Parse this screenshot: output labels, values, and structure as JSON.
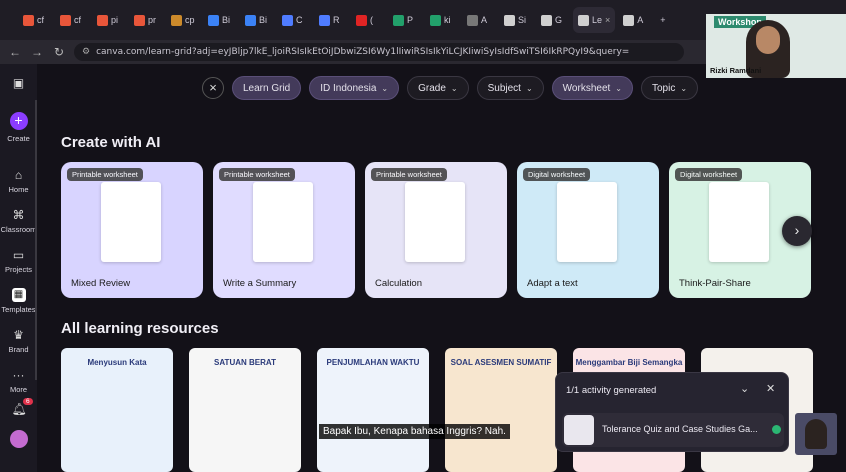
{
  "browser": {
    "tabs": [
      {
        "label": "cf",
        "color": "#e8563a"
      },
      {
        "label": "cf",
        "color": "#e8563a"
      },
      {
        "label": "pi",
        "color": "#e8563a"
      },
      {
        "label": "pr",
        "color": "#e8563a"
      },
      {
        "label": "cp",
        "color": "#cc8a2b"
      },
      {
        "label": "Bi",
        "color": "#3b82f6"
      },
      {
        "label": "Bi",
        "color": "#3b82f6"
      },
      {
        "label": "C",
        "color": "#4f7cff"
      },
      {
        "label": "R",
        "color": "#4f7cff"
      },
      {
        "label": "(",
        "color": "#e02424"
      },
      {
        "label": "P",
        "color": "#22a06b"
      },
      {
        "label": "ki",
        "color": "#22a06b"
      },
      {
        "label": "A",
        "color": "#777777"
      },
      {
        "label": "Si",
        "color": "#cfcfcf"
      },
      {
        "label": "G",
        "color": "#cfcfcf"
      },
      {
        "label": "Le",
        "color": "#cfcfcf",
        "active": true
      },
      {
        "label": "A",
        "color": "#cfcfcf"
      }
    ],
    "new_tab": "+",
    "url": "canva.com/learn-grid?adj=eyJBljp7lkE_ljoiRSIsIkEtOiJDbwiZSI6Wy1lIiwiRSIsIkYiLCJKIiwiSyIsIdfSwiTSI6IkRPQyI9&query="
  },
  "sidebar": {
    "items": [
      {
        "label": "Create",
        "icon": "plus-icon"
      },
      {
        "label": "Home",
        "icon": "home-icon"
      },
      {
        "label": "Classroom",
        "icon": "classroom-icon"
      },
      {
        "label": "Projects",
        "icon": "folder-icon"
      },
      {
        "label": "Templates",
        "icon": "templates-icon"
      },
      {
        "label": "Brand",
        "icon": "brand-icon"
      },
      {
        "label": "More",
        "icon": "more-icon"
      }
    ],
    "notification_count": "6"
  },
  "filters": {
    "chips": [
      {
        "label": "Learn Grid",
        "selected": true
      },
      {
        "label": "ID Indonesia",
        "selected": true,
        "dropdown": true
      },
      {
        "label": "Grade",
        "dropdown": true
      },
      {
        "label": "Subject",
        "dropdown": true
      },
      {
        "label": "Worksheet",
        "selected": true,
        "dropdown": true
      },
      {
        "label": "Topic",
        "dropdown": true
      }
    ]
  },
  "sections": {
    "ai_title": "Create with AI",
    "resources_title": "All learning resources"
  },
  "ai_cards": [
    {
      "tag": "Printable worksheet",
      "label": "Mixed Review",
      "color": "#d8d4ff"
    },
    {
      "tag": "Printable worksheet",
      "label": "Write a Summary",
      "color": "#e0dcff"
    },
    {
      "tag": "Printable worksheet",
      "label": "Calculation",
      "color": "#e6e4f7"
    },
    {
      "tag": "Digital worksheet",
      "label": "Adapt a text",
      "color": "#cfeaf7"
    },
    {
      "tag": "Digital worksheet",
      "label": "Think-Pair-Share",
      "color": "#d7f2e4"
    }
  ],
  "resources": [
    {
      "title": "Menyusun Kata",
      "bg": "#e8f1fb"
    },
    {
      "title": "SATUAN BERAT",
      "bg": "#f6f6f6"
    },
    {
      "title": "PENJUMLAHAN WAKTU",
      "bg": "#eef3fb"
    },
    {
      "title": "SOAL ASESMEN SUMATIF",
      "bg": "#f7e6cf"
    },
    {
      "title": "Menggambar Biji Semangka",
      "bg": "#fbe4e6"
    },
    {
      "title": "",
      "bg": "#f4f1ec"
    }
  ],
  "toast": {
    "header": "1/1 activity generated",
    "item": "Tolerance Quiz and Case Studies Ga..."
  },
  "caption": "Bapak Ibu, Kenapa bahasa Inggris? Nah.",
  "webcam": {
    "name": "Rizki Ramdani",
    "banner": "Workshop"
  }
}
